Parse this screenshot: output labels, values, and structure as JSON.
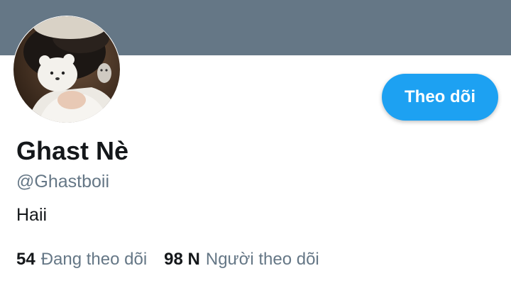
{
  "profile": {
    "display_name": "Ghast Nè",
    "handle": "@Ghastboii",
    "bio": "Haii",
    "avatar": "profile-photo"
  },
  "actions": {
    "follow_label": "Theo dõi"
  },
  "stats": {
    "following_count": "54",
    "following_label": "Đang theo dõi",
    "followers_count": "98 N",
    "followers_label": "Người theo dõi"
  },
  "colors": {
    "banner": "#657786",
    "accent": "#1da1f2",
    "text_primary": "#14171a",
    "text_secondary": "#657786"
  }
}
